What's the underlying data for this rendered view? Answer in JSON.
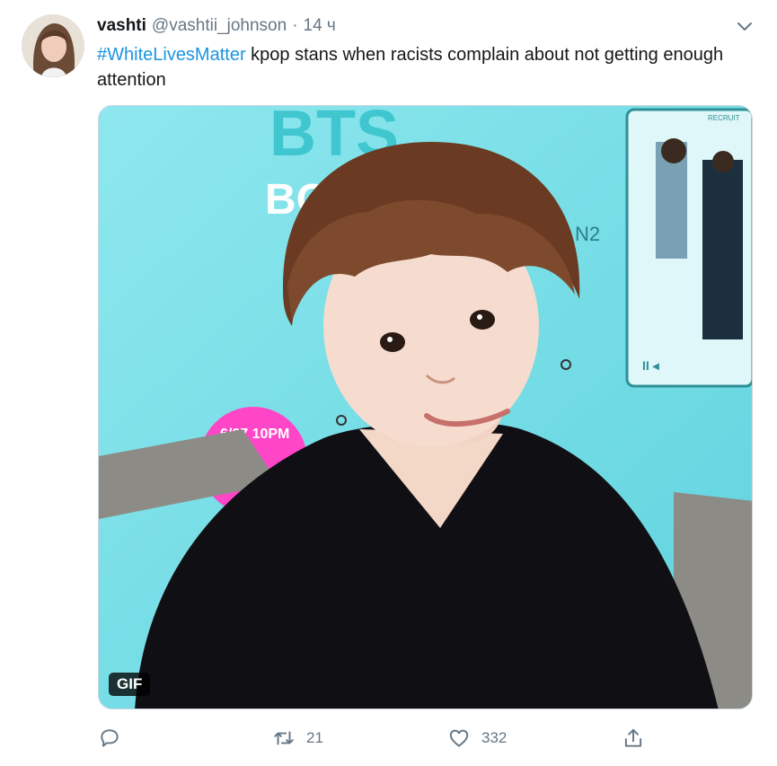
{
  "author": {
    "name": "vashti",
    "handle": "@vashtii_johnson",
    "separator": "·",
    "time": "14 ч"
  },
  "tweet": {
    "hashtag": "#WhiteLivesMatter",
    "text": " kpop stans when racists complain about not getting enough attention"
  },
  "media": {
    "badge": "GIF",
    "scene_text": {
      "sign_title": "BTS",
      "sign_sub": "BO   GE",
      "sign_line": "N2",
      "date_bubble": "6/27 10PM",
      "corner_mark": "RECRUIT"
    }
  },
  "actions": {
    "reply_icon": "reply-icon",
    "retweet_icon": "retweet-icon",
    "retweet_count": "21",
    "like_icon": "heart-icon",
    "like_count": "332",
    "share_icon": "share-icon"
  },
  "colors": {
    "hashtag": "#1b95e0",
    "muted": "#657786",
    "background_cyan": "#7fe0e8"
  }
}
